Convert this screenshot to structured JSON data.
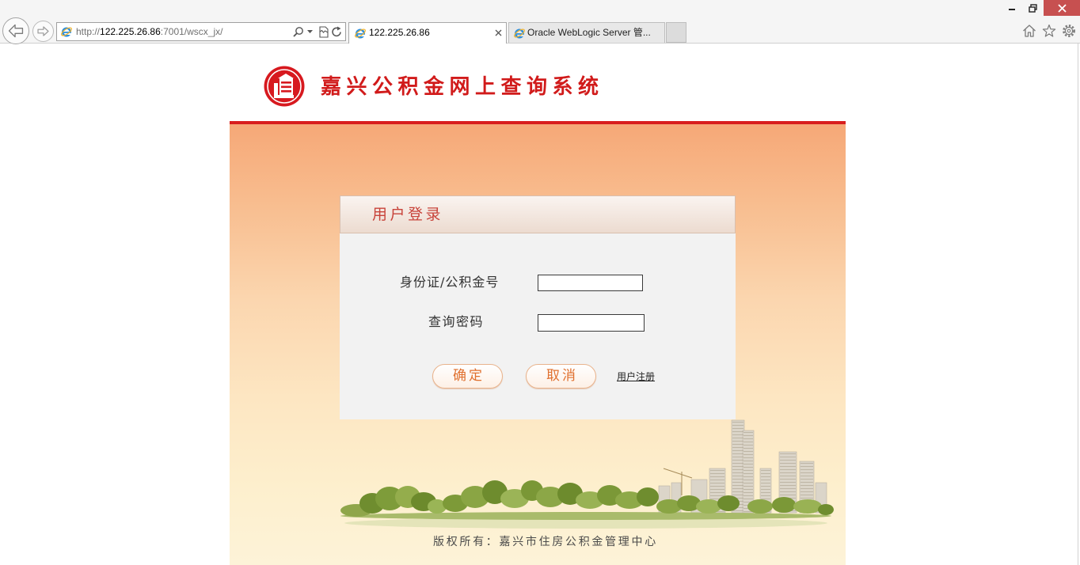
{
  "window": {
    "controls": [
      "minimize-icon",
      "restore-icon",
      "close-icon"
    ]
  },
  "browser": {
    "nav": {
      "back_icon": "back-arrow-icon",
      "forward_icon": "forward-arrow-icon"
    },
    "address_bar": {
      "scheme": "http://",
      "host": "122.225.26.86",
      "path": ":7001/wscx_jx/",
      "icons": [
        "ie-icon",
        "search-icon",
        "search-dropdown-icon",
        "compat-view-icon",
        "refresh-icon"
      ]
    },
    "tabs": [
      {
        "label": "122.225.26.86",
        "active": true,
        "icon": "ie-icon",
        "close_icon": "close-tab-icon"
      },
      {
        "label": "Oracle WebLogic Server 管...",
        "active": false,
        "icon": "ie-icon"
      }
    ],
    "toolbar_icons": [
      "home-icon",
      "star-icon",
      "gear-icon"
    ]
  },
  "page": {
    "logo_icon": "housing-fund-emblem-icon",
    "site_title": "嘉兴公积金网上查询系统",
    "login": {
      "title": "用户登录",
      "id_label": "身份证/公积金号",
      "password_label": "查询密码",
      "confirm_button": "确定",
      "cancel_button": "取消",
      "register_link": "用户注册"
    },
    "footer": "版权所有：嘉兴市住房公积金管理中心"
  },
  "colors": {
    "brand_red": "#d81e1e",
    "login_title": "#c8433a",
    "button_text": "#e0702e",
    "panel_gradient_top": "#f6a877",
    "panel_gradient_bottom": "#fdf3d8",
    "form_background": "#f2f2f2"
  }
}
